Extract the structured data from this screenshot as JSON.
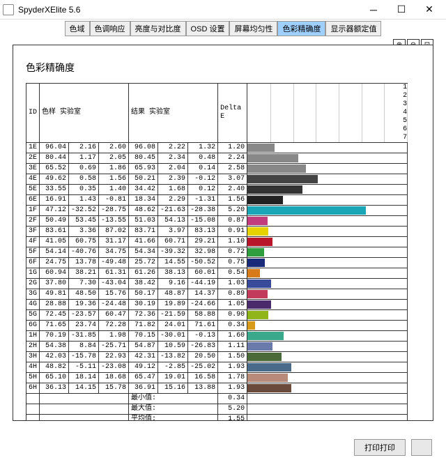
{
  "window": {
    "title": "SpyderXElite 5.6"
  },
  "tabs": [
    "色域",
    "色调响应",
    "亮度与对比度",
    "OSD 设置",
    "屏幕均匀性",
    "色彩精确度",
    "显示器额定值"
  ],
  "activeTab": 5,
  "pageTitle": "色彩精确度",
  "headers": {
    "id": "ID",
    "sample": "色样  实验室",
    "result": "结果  实验室",
    "delta": "Delta E"
  },
  "axisTicks": [
    1,
    2,
    3,
    4,
    5,
    6,
    7
  ],
  "axisMax": 7,
  "rows": [
    {
      "id": "1E",
      "s": [
        96.04,
        2.16,
        2.6
      ],
      "r": [
        96.08,
        2.22,
        1.32
      ],
      "d": 1.2,
      "c": "#888"
    },
    {
      "id": "2E",
      "s": [
        80.44,
        1.17,
        2.05
      ],
      "r": [
        80.45,
        2.34,
        0.48
      ],
      "d": 2.24,
      "c": "#888"
    },
    {
      "id": "3E",
      "s": [
        65.52,
        0.69,
        1.86
      ],
      "r": [
        65.93,
        2.04,
        0.14
      ],
      "d": 2.58,
      "c": "#888"
    },
    {
      "id": "4E",
      "s": [
        49.62,
        0.58,
        1.56
      ],
      "r": [
        50.21,
        2.39,
        -0.12
      ],
      "d": 3.07,
      "c": "#444"
    },
    {
      "id": "5E",
      "s": [
        33.55,
        0.35,
        1.4
      ],
      "r": [
        34.42,
        1.68,
        0.12
      ],
      "d": 2.4,
      "c": "#333"
    },
    {
      "id": "6E",
      "s": [
        16.91,
        1.43,
        -0.81
      ],
      "r": [
        18.34,
        2.29,
        -1.31
      ],
      "d": 1.56,
      "c": "#222"
    },
    {
      "id": "1F",
      "s": [
        47.12,
        -32.52,
        -28.75
      ],
      "r": [
        48.62,
        -21.63,
        -28.38
      ],
      "d": 5.2,
      "c": "#1aa6b7"
    },
    {
      "id": "2F",
      "s": [
        50.49,
        53.45,
        -13.55
      ],
      "r": [
        51.03,
        54.13,
        -15.08
      ],
      "d": 0.87,
      "c": "#c23b7c"
    },
    {
      "id": "3F",
      "s": [
        83.61,
        3.36,
        87.02
      ],
      "r": [
        83.71,
        3.97,
        83.13
      ],
      "d": 0.91,
      "c": "#e6d200"
    },
    {
      "id": "4F",
      "s": [
        41.05,
        60.75,
        31.17
      ],
      "r": [
        41.66,
        60.71,
        29.21
      ],
      "d": 1.1,
      "c": "#b8152a"
    },
    {
      "id": "5F",
      "s": [
        54.14,
        -40.76,
        34.75
      ],
      "r": [
        54.34,
        -39.32,
        32.98
      ],
      "d": 0.72,
      "c": "#2f9e3f"
    },
    {
      "id": "6F",
      "s": [
        24.75,
        13.78,
        -49.48
      ],
      "r": [
        25.72,
        14.55,
        -50.52
      ],
      "d": 0.75,
      "c": "#1a2a7a"
    },
    {
      "id": "1G",
      "s": [
        60.94,
        38.21,
        61.31
      ],
      "r": [
        61.26,
        38.13,
        60.01
      ],
      "d": 0.54,
      "c": "#d67a1a"
    },
    {
      "id": "2G",
      "s": [
        37.8,
        7.3,
        -43.04
      ],
      "r": [
        38.42,
        9.16,
        -44.19
      ],
      "d": 1.03,
      "c": "#3a4a9a"
    },
    {
      "id": "3G",
      "s": [
        49.81,
        48.5,
        15.76
      ],
      "r": [
        50.17,
        48.87,
        14.37
      ],
      "d": 0.89,
      "c": "#c23b5a"
    },
    {
      "id": "4G",
      "s": [
        28.88,
        19.36,
        -24.48
      ],
      "r": [
        30.19,
        19.89,
        -24.66
      ],
      "d": 1.05,
      "c": "#4a2a6a"
    },
    {
      "id": "5G",
      "s": [
        72.45,
        -23.57,
        60.47
      ],
      "r": [
        72.36,
        -21.59,
        58.88
      ],
      "d": 0.9,
      "c": "#8fb51a"
    },
    {
      "id": "6G",
      "s": [
        71.65,
        23.74,
        72.28
      ],
      "r": [
        71.82,
        24.01,
        71.61
      ],
      "d": 0.34,
      "c": "#d89a1a"
    },
    {
      "id": "1H",
      "s": [
        70.19,
        -31.85,
        1.98
      ],
      "r": [
        70.15,
        -30.01,
        -0.13
      ],
      "d": 1.6,
      "c": "#3aa88a"
    },
    {
      "id": "2H",
      "s": [
        54.38,
        8.84,
        -25.71
      ],
      "r": [
        54.87,
        10.59,
        -26.83
      ],
      "d": 1.11,
      "c": "#6a7aaa"
    },
    {
      "id": "3H",
      "s": [
        42.03,
        -15.78,
        22.93
      ],
      "r": [
        42.31,
        -13.82,
        20.5
      ],
      "d": 1.5,
      "c": "#4a6a3a"
    },
    {
      "id": "4H",
      "s": [
        48.82,
        -5.11,
        -23.08
      ],
      "r": [
        49.12,
        -2.85,
        -25.02
      ],
      "d": 1.93,
      "c": "#4a6a8a"
    },
    {
      "id": "5H",
      "s": [
        65.1,
        18.14,
        18.68
      ],
      "r": [
        65.47,
        19.01,
        16.58
      ],
      "d": 1.78,
      "c": "#b88a7a"
    },
    {
      "id": "6H",
      "s": [
        36.13,
        14.15,
        15.78
      ],
      "r": [
        36.91,
        15.16,
        13.88
      ],
      "d": 1.93,
      "c": "#6a4a3a"
    }
  ],
  "summary": [
    {
      "label": "最小值:",
      "val": 0.34
    },
    {
      "label": "最大值:",
      "val": 5.2
    },
    {
      "label": "平均值:",
      "val": 1.55
    }
  ],
  "footer": {
    "print": "打印打印",
    "blank": " "
  }
}
